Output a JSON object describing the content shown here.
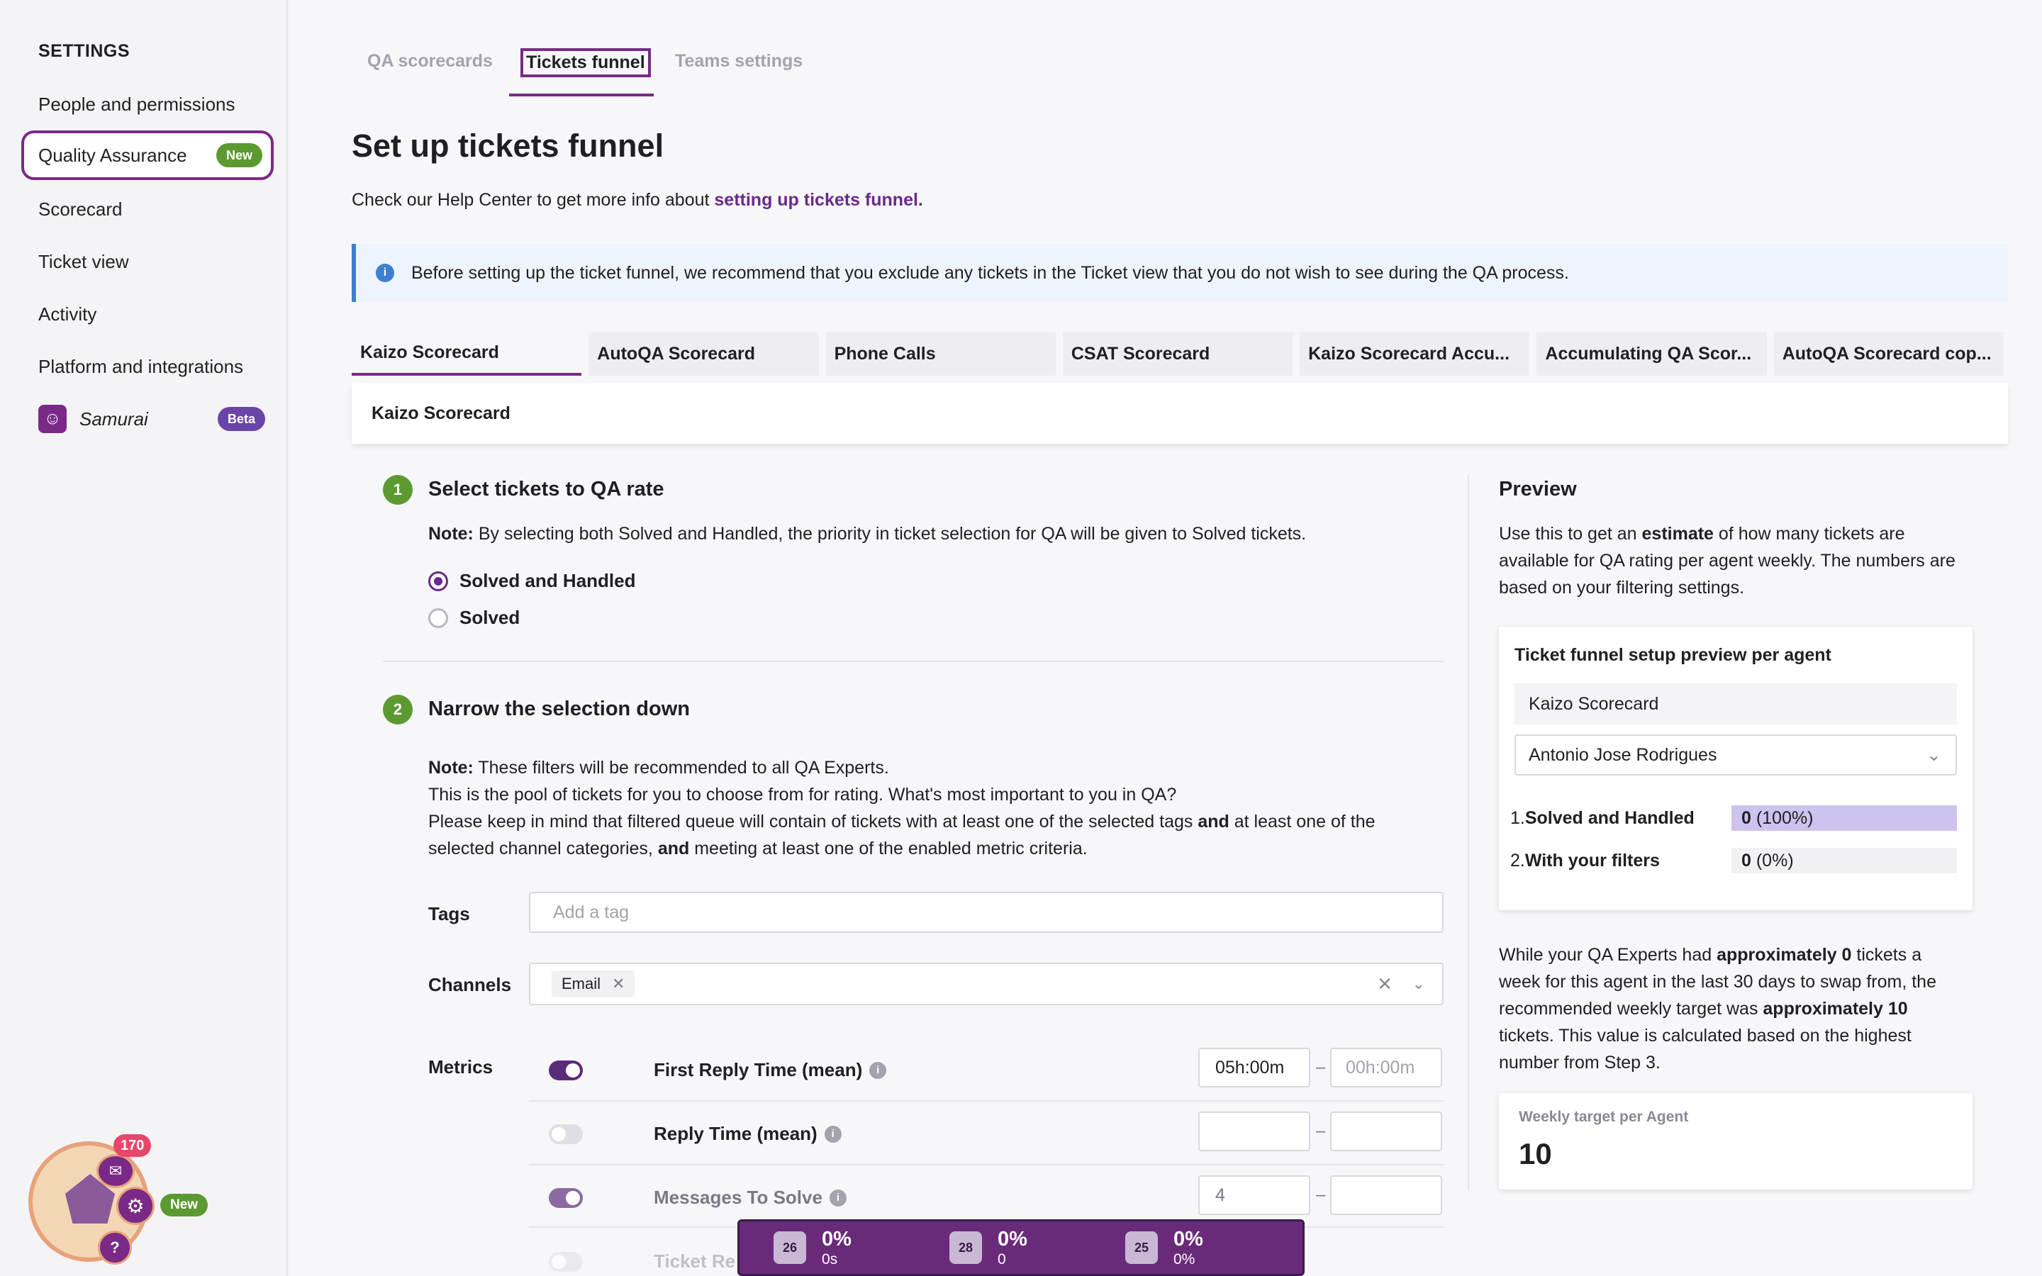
{
  "sidebar": {
    "title": "SETTINGS",
    "items": [
      {
        "label": "People and permissions"
      },
      {
        "label": "Quality Assurance",
        "badge": "New"
      },
      {
        "label": "Scorecard"
      },
      {
        "label": "Ticket view"
      },
      {
        "label": "Activity"
      },
      {
        "label": "Platform and integrations"
      },
      {
        "label": "Samurai",
        "badge": "Beta"
      }
    ]
  },
  "tabs": [
    "QA scorecards",
    "Tickets funnel",
    "Teams settings"
  ],
  "page": {
    "title": "Set up tickets funnel",
    "help_prefix": "Check our Help Center to get more info about ",
    "help_link": "setting up tickets funnel.",
    "info": "Before setting up the ticket funnel, we recommend that you exclude any tickets in the Ticket view that you do not wish to see during the QA process."
  },
  "scorecard_tabs": [
    "Kaizo Scorecard",
    "AutoQA Scorecard",
    "Phone Calls",
    "CSAT Scorecard",
    "Kaizo Scorecard Accu...",
    "Accumulating QA Scor...",
    "AutoQA Scorecard cop..."
  ],
  "scorecard_header": "Kaizo Scorecard",
  "step1": {
    "num": "1",
    "title": "Select tickets to QA rate",
    "note_bold": "Note:",
    "note": " By selecting both Solved and Handled, the priority in ticket selection for QA will be given to Solved tickets.",
    "options": [
      "Solved and Handled",
      "Solved"
    ]
  },
  "step2": {
    "num": "2",
    "title": "Narrow the selection down",
    "note_bold": "Note:",
    "note": " These filters will be recommended to all QA Experts.",
    "line2": "This is the pool of tickets for you to choose from for rating. What's most important to you in QA?",
    "line3a": "Please keep in mind that filtered queue will contain of tickets with at least one of the selected tags ",
    "and1": "and",
    "line3b": " at least one of the",
    "line4a": "selected channel categories, ",
    "and2": "and",
    "line4b": " meeting at least one of the enabled metric criteria.",
    "tags_label": "Tags",
    "tags_placeholder": "Add a tag",
    "channels_label": "Channels",
    "channel_chip": "Email",
    "metrics_label": "Metrics",
    "metrics": [
      {
        "name": "First Reply Time (mean)",
        "min": "05h:00m",
        "max_placeholder": "00h:00m"
      },
      {
        "name": "Reply Time (mean)",
        "min": "",
        "max_placeholder": ""
      },
      {
        "name": "Messages To Solve",
        "min": "4",
        "max_placeholder": ""
      },
      {
        "name": "Ticket Re",
        "min": "",
        "max_placeholder": ""
      }
    ]
  },
  "preview": {
    "title": "Preview",
    "desc_a": "Use this to get an ",
    "desc_bold": "estimate",
    "desc_b": " of how many tickets are",
    "desc_line2": "available for QA rating per agent weekly. The numbers are",
    "desc_line3": "based on your filtering settings.",
    "card_title": "Ticket funnel setup preview per agent",
    "scorecard": "Kaizo Scorecard",
    "agent": "Antonio Jose Rodrigues",
    "rows": [
      {
        "label": "1. ",
        "label_bold": "Solved and Handled",
        "value": "0",
        "pct": "(100%)",
        "fill": 100
      },
      {
        "label": "2. ",
        "label_bold": "With your filters",
        "value": "0",
        "pct": "(0%)",
        "fill": 0
      }
    ],
    "summary_1a": "While your QA Experts had ",
    "summary_1b": "approximately 0",
    "summary_1c": " tickets a",
    "summary_2": "week for this agent in the last 30 days to swap from, the",
    "summary_3a": "recommended weekly target was ",
    "summary_3b": "approximately 10",
    "summary_4": "tickets. This value is calculated based on the highest",
    "summary_5": "number from Step 3.",
    "target_label": "Weekly target per Agent",
    "target_value": "10"
  },
  "widget": {
    "count": "170",
    "badge": "New"
  },
  "hud": [
    {
      "level": "26",
      "pct": "0%",
      "sub": "0s"
    },
    {
      "level": "28",
      "pct": "0%",
      "sub": "0"
    },
    {
      "level": "25",
      "pct": "0%",
      "sub": "0%"
    }
  ],
  "colors": {
    "accent": "#7a2a86",
    "green": "#5c9a31",
    "info": "#3f7fd0"
  }
}
